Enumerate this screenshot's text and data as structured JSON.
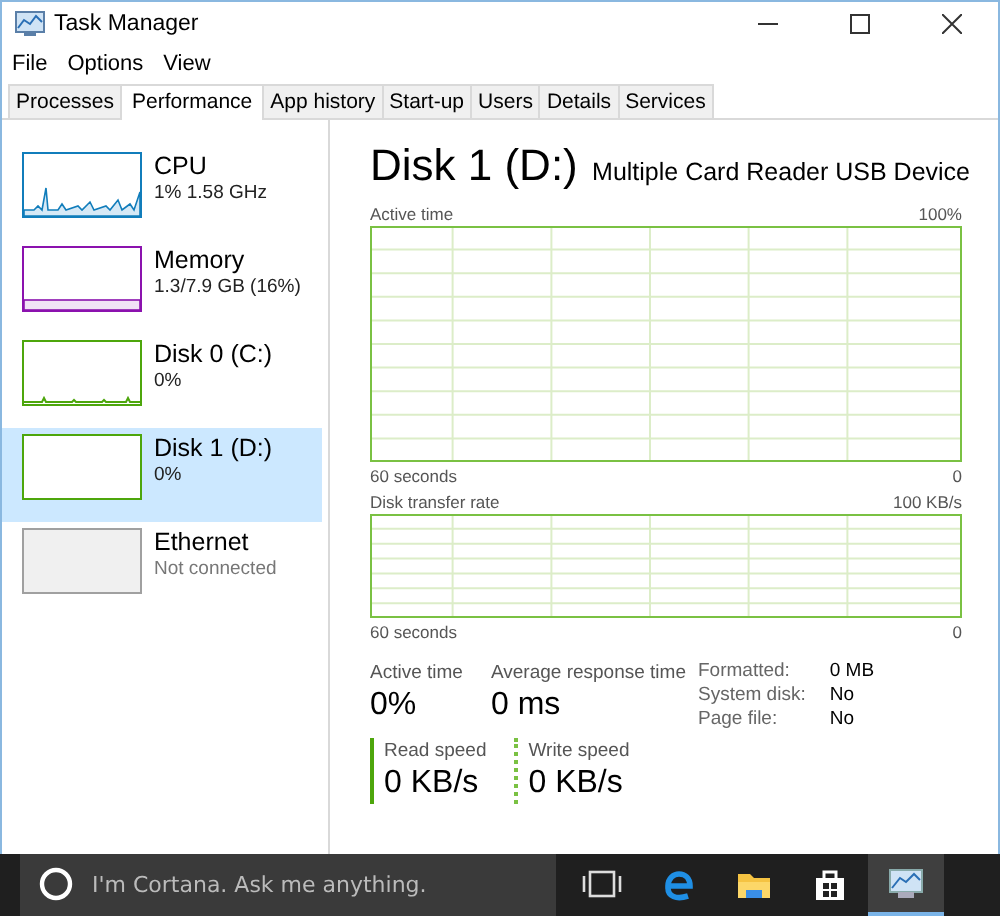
{
  "window": {
    "title": "Task Manager"
  },
  "menu": [
    "File",
    "Options",
    "View"
  ],
  "tabs": [
    {
      "label": "Processes",
      "selected": false
    },
    {
      "label": "Performance",
      "selected": true
    },
    {
      "label": "App history",
      "selected": false
    },
    {
      "label": "Start-up",
      "selected": false
    },
    {
      "label": "Users",
      "selected": false
    },
    {
      "label": "Details",
      "selected": false
    },
    {
      "label": "Services",
      "selected": false
    }
  ],
  "sidebar": {
    "items": [
      {
        "name": "CPU",
        "detail": "1% 1.58 GHz",
        "kind": "spiky",
        "color": "#117dbb",
        "selected": false,
        "disabled": false
      },
      {
        "name": "Memory",
        "detail": "1.3/7.9 GB (16%)",
        "kind": "band",
        "color": "#8b12ae",
        "selected": false,
        "disabled": false
      },
      {
        "name": "Disk 0 (C:)",
        "detail": "0%",
        "kind": "flat",
        "color": "#4da60c",
        "selected": false,
        "disabled": false
      },
      {
        "name": "Disk 1 (D:)",
        "detail": "0%",
        "kind": "empty",
        "color": "#4da60c",
        "selected": true,
        "disabled": false
      },
      {
        "name": "Ethernet",
        "detail": "Not connected",
        "kind": "empty",
        "color": "#a0a0a0",
        "selected": false,
        "disabled": true
      }
    ]
  },
  "panel": {
    "title": "Disk 1 (D:)",
    "device": "Multiple Card Reader USB Device",
    "graphs": [
      {
        "label": "Active time",
        "max": "100%",
        "span": "60 seconds",
        "min": "0"
      },
      {
        "label": "Disk transfer rate",
        "max": "100 KB/s",
        "span": "60 seconds",
        "min": "0"
      }
    ],
    "stats": [
      {
        "label": "Active time",
        "value": "0%"
      },
      {
        "label": "Average response time",
        "value": "0 ms"
      }
    ],
    "properties": [
      {
        "label": "Formatted:",
        "value": "0 MB"
      },
      {
        "label": "System disk:",
        "value": "No"
      },
      {
        "label": "Page file:",
        "value": "No"
      }
    ],
    "speeds": [
      {
        "label": "Read speed",
        "value": "0 KB/s",
        "kind": "solid"
      },
      {
        "label": "Write speed",
        "value": "0 KB/s",
        "kind": "dotted"
      }
    ]
  },
  "taskbar": {
    "search_placeholder": "I'm Cortana. Ask me anything.",
    "apps": [
      {
        "kind": "task-view",
        "selected": false
      },
      {
        "kind": "browser",
        "selected": false
      },
      {
        "kind": "folder",
        "selected": false
      },
      {
        "kind": "store",
        "selected": false
      },
      {
        "kind": "task-manager",
        "selected": true
      }
    ]
  }
}
